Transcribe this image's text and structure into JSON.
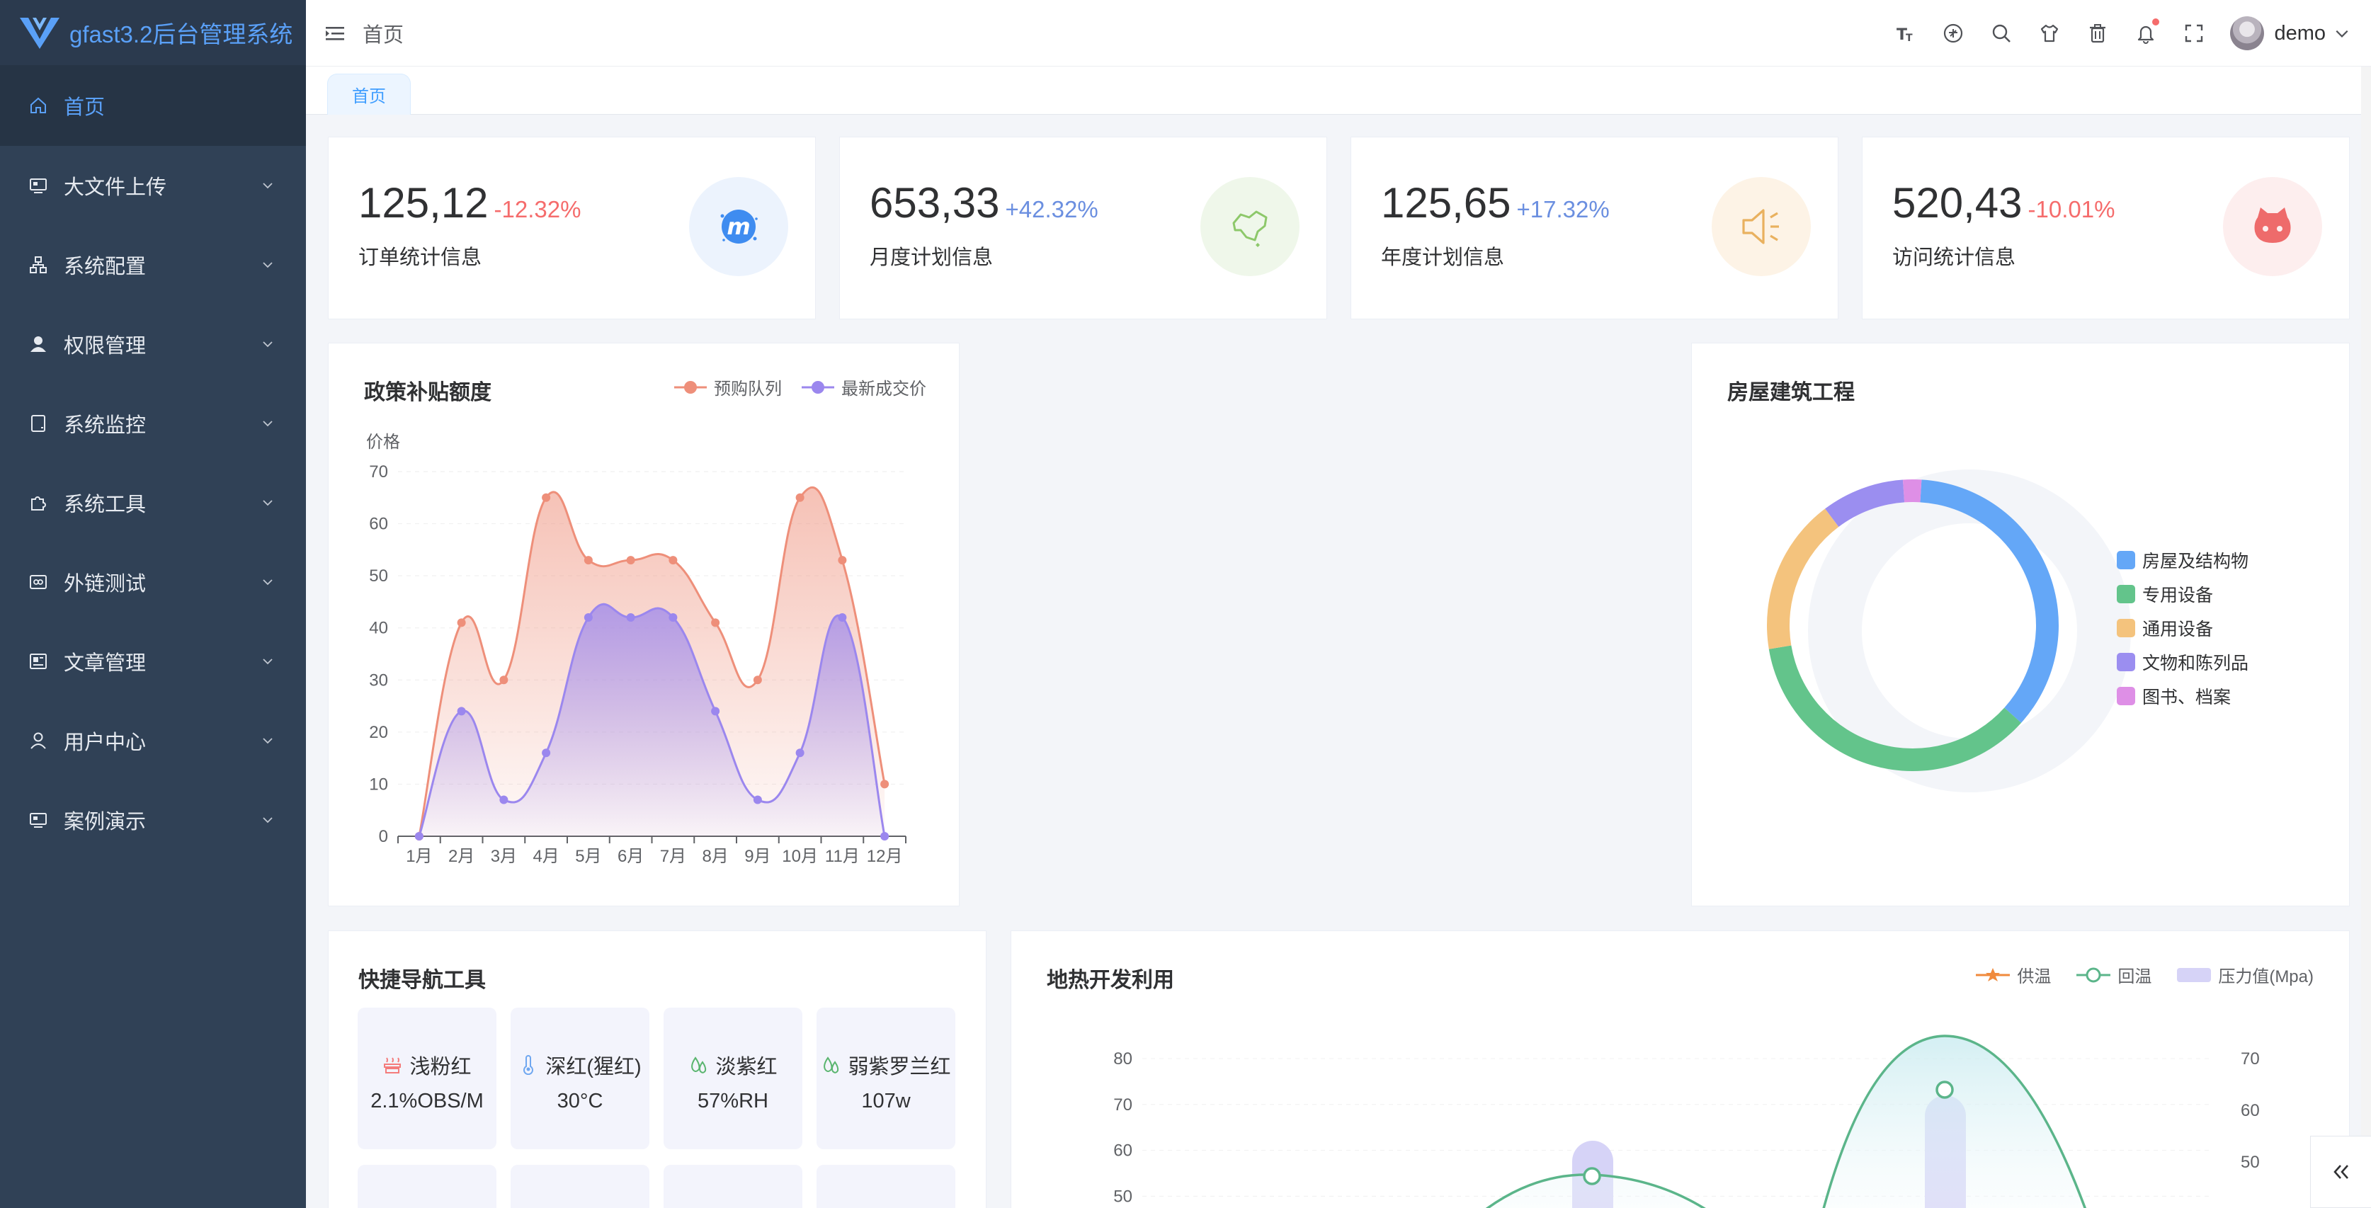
{
  "app": {
    "title": "gfast3.2后台管理系统"
  },
  "sidebar": {
    "items": [
      {
        "label": "首页",
        "icon": "home-icon",
        "active": true
      },
      {
        "label": "大文件上传",
        "icon": "monitor-icon"
      },
      {
        "label": "系统配置",
        "icon": "sitemap-icon"
      },
      {
        "label": "权限管理",
        "icon": "user-solid-icon"
      },
      {
        "label": "系统监控",
        "icon": "tablet-icon"
      },
      {
        "label": "系统工具",
        "icon": "puzzle-icon"
      },
      {
        "label": "外链测试",
        "icon": "link-box-icon"
      },
      {
        "label": "文章管理",
        "icon": "article-icon"
      },
      {
        "label": "用户中心",
        "icon": "user-icon"
      },
      {
        "label": "案例演示",
        "icon": "monitor-icon"
      }
    ]
  },
  "header": {
    "breadcrumb": "首页",
    "username": "demo"
  },
  "tags": {
    "active": "首页"
  },
  "stats": [
    {
      "value": "125,12",
      "change": "-12.32%",
      "direction": "down",
      "label": "订单统计信息",
      "icon": "m-logo-icon",
      "color": "#3f8cf0",
      "bg": "#ecf3fd"
    },
    {
      "value": "653,33",
      "change": "+42.32%",
      "direction": "up",
      "label": "月度计划信息",
      "icon": "map-icon",
      "color": "#8dc86a",
      "bg": "#eff7ea"
    },
    {
      "value": "125,65",
      "change": "+17.32%",
      "direction": "up",
      "label": "年度计划信息",
      "icon": "speaker-icon",
      "color": "#e9b15f",
      "bg": "#fdf3e6"
    },
    {
      "value": "520,43",
      "change": "-10.01%",
      "direction": "down",
      "label": "访问统计信息",
      "icon": "github-icon",
      "color": "#ee6b6b",
      "bg": "#fdeeee"
    }
  ],
  "policy_card": {
    "title": "政策补贴额度"
  },
  "house_card": {
    "title": "房屋建筑工程"
  },
  "quick_nav": {
    "title": "快捷导航工具",
    "items": [
      {
        "label": "浅粉红",
        "value": "2.1%OBS/M",
        "icon": "fire-icon",
        "color": "#f47c7c"
      },
      {
        "label": "深红(猩红)",
        "value": "30°C",
        "icon": "thermometer-icon",
        "color": "#6fa7f0"
      },
      {
        "label": "淡紫红",
        "value": "57%RH",
        "icon": "drops-icon",
        "color": "#5ab56f"
      },
      {
        "label": "弱紫罗兰红",
        "value": "107w",
        "icon": "drops-icon",
        "color": "#5ab56f"
      }
    ]
  },
  "geo_card": {
    "title": "地热开发利用"
  },
  "chart_data": [
    {
      "type": "area",
      "ylabel": "价格",
      "ylim": [
        0,
        70
      ],
      "yticks": [
        0,
        10,
        20,
        30,
        40,
        50,
        60,
        70
      ],
      "categories": [
        "1月",
        "2月",
        "3月",
        "4月",
        "5月",
        "6月",
        "7月",
        "8月",
        "9月",
        "10月",
        "11月",
        "12月"
      ],
      "grid": true,
      "legend_position": "top-right",
      "series": [
        {
          "name": "预购队列",
          "color": "#ee8f7a",
          "values": [
            0,
            41,
            30,
            65,
            53,
            53,
            53,
            41,
            30,
            65,
            53,
            10
          ]
        },
        {
          "name": "最新成交价",
          "color": "#9b87ee",
          "values": [
            0,
            24,
            7,
            16,
            42,
            42,
            42,
            24,
            7,
            16,
            42,
            0
          ]
        }
      ]
    },
    {
      "type": "pie",
      "legend_position": "right",
      "series": [
        {
          "name": "房屋及结构物",
          "color": "#64a7f7",
          "value": 35
        },
        {
          "name": "专用设备",
          "color": "#63c48b",
          "value": 35
        },
        {
          "name": "通用设备",
          "color": "#f4c37d",
          "value": 17
        },
        {
          "name": "文物和陈列品",
          "color": "#9b8ef0",
          "value": 9
        },
        {
          "name": "图书、档案",
          "color": "#de8fe6",
          "value": 2
        }
      ]
    },
    {
      "type": "line",
      "legend_position": "top-right",
      "left_ticks": [
        50,
        60,
        70,
        80
      ],
      "right_ticks": [
        50,
        60,
        70
      ],
      "series": [
        {
          "name": "供温",
          "color": "#f08a3c"
        },
        {
          "name": "回温",
          "color": "#5bb58a"
        },
        {
          "name": "压力值(Mpa)",
          "color": "#d6d3f7"
        }
      ]
    }
  ]
}
